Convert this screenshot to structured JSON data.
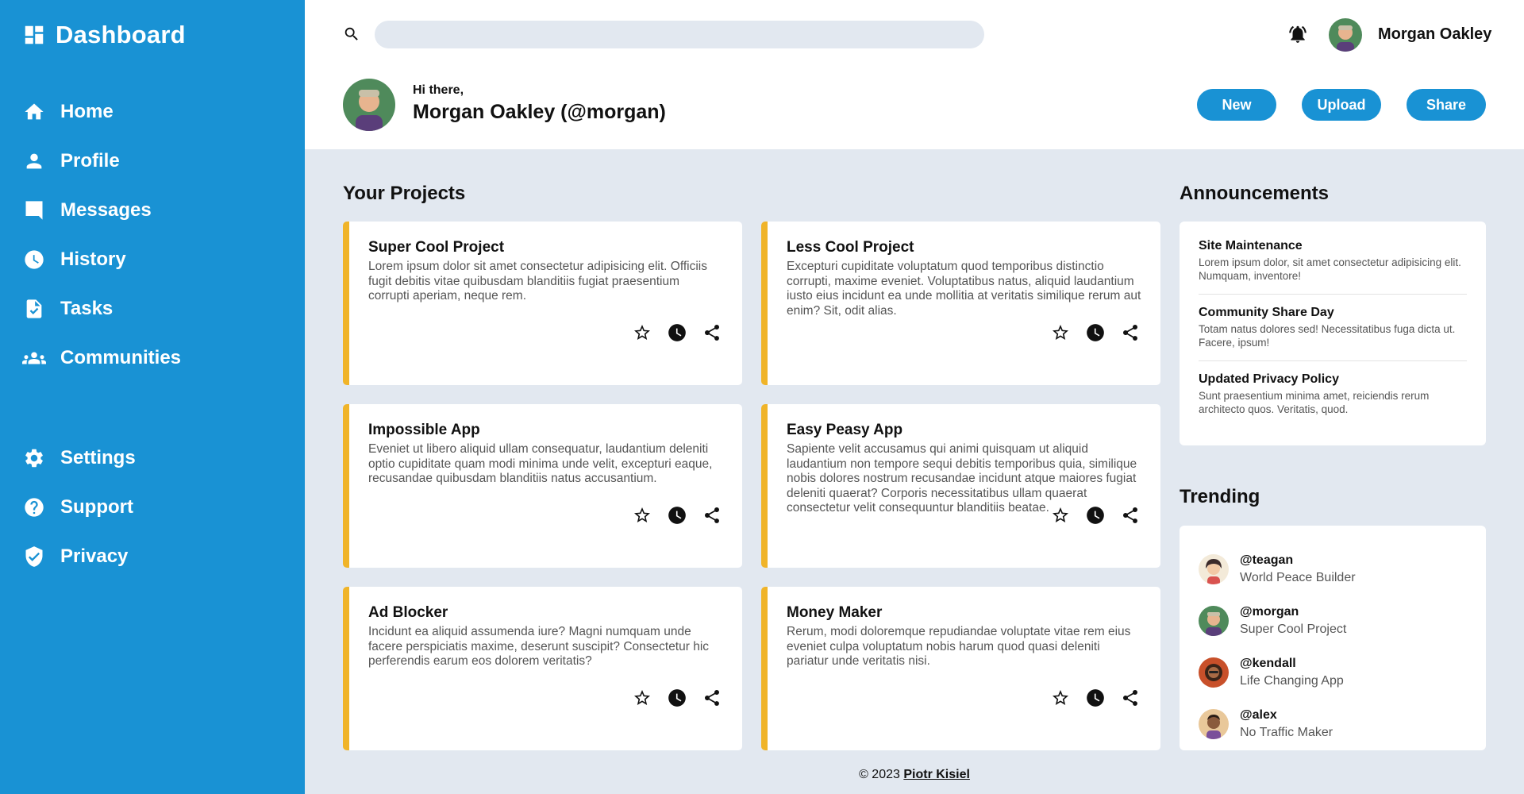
{
  "sidebar": {
    "brand": "Dashboard",
    "main_items": [
      {
        "label": "Home",
        "icon": "home-icon"
      },
      {
        "label": "Profile",
        "icon": "person-icon"
      },
      {
        "label": "Messages",
        "icon": "chat-icon"
      },
      {
        "label": "History",
        "icon": "clock-icon"
      },
      {
        "label": "Tasks",
        "icon": "task-icon"
      },
      {
        "label": "Communities",
        "icon": "group-icon"
      }
    ],
    "bottom_items": [
      {
        "label": "Settings",
        "icon": "gear-icon"
      },
      {
        "label": "Support",
        "icon": "help-icon"
      },
      {
        "label": "Privacy",
        "icon": "shield-icon"
      }
    ]
  },
  "header": {
    "search_placeholder": "",
    "user_name": "Morgan Oakley",
    "greeting": "Hi there,",
    "greeting_name": "Morgan Oakley (@morgan)",
    "buttons": {
      "new": "New",
      "upload": "Upload",
      "share": "Share"
    }
  },
  "projects": {
    "title": "Your Projects",
    "items": [
      {
        "title": "Super Cool Project",
        "desc": "Lorem ipsum dolor sit amet consectetur adipisicing elit. Officiis fugit debitis vitae quibusdam blanditiis fugiat praesentium corrupti aperiam, neque rem."
      },
      {
        "title": "Less Cool Project",
        "desc": "Excepturi cupiditate voluptatum quod temporibus distinctio corrupti, maxime eveniet. Voluptatibus natus, aliquid laudantium iusto eius incidunt ea unde mollitia at veritatis similique rerum aut enim? Sit, odit alias."
      },
      {
        "title": "Impossible App",
        "desc": "Eveniet ut libero aliquid ullam consequatur, laudantium deleniti optio cupiditate quam modi minima unde velit, excepturi eaque, recusandae quibusdam blanditiis natus accusantium."
      },
      {
        "title": "Easy Peasy App",
        "desc": "Sapiente velit accusamus qui animi quisquam ut aliquid laudantium non tempore sequi debitis temporibus quia, similique nobis dolores nostrum recusandae incidunt atque maiores fugiat deleniti quaerat? Corporis necessitatibus ullam quaerat consectetur velit consequuntur blanditiis beatae."
      },
      {
        "title": "Ad Blocker",
        "desc": "Incidunt ea aliquid assumenda iure? Magni numquam unde facere perspiciatis maxime, deserunt suscipit? Consectetur hic perferendis earum eos dolorem veritatis?"
      },
      {
        "title": "Money Maker",
        "desc": "Rerum, modi doloremque repudiandae voluptate vitae rem eius eveniet culpa voluptatum nobis harum quod quasi deleniti pariatur unde veritatis nisi."
      }
    ]
  },
  "announcements": {
    "title": "Announcements",
    "items": [
      {
        "title": "Site Maintenance",
        "desc": "Lorem ipsum dolor, sit amet consectetur adipisicing elit. Numquam, inventore!"
      },
      {
        "title": "Community Share Day",
        "desc": "Totam natus dolores sed! Necessitatibus fuga dicta ut. Facere, ipsum!"
      },
      {
        "title": "Updated Privacy Policy",
        "desc": "Sunt praesentium minima amet, reiciendis rerum architecto quos. Veritatis, quod."
      }
    ]
  },
  "trending": {
    "title": "Trending",
    "items": [
      {
        "handle": "@teagan",
        "sub": "World Peace Builder"
      },
      {
        "handle": "@morgan",
        "sub": "Super Cool Project"
      },
      {
        "handle": "@kendall",
        "sub": "Life Changing App"
      },
      {
        "handle": "@alex",
        "sub": "No Traffic Maker"
      }
    ]
  },
  "footer": {
    "copyright": "© 2023",
    "author": "Piotr Kisiel"
  },
  "colors": {
    "primary": "#1992d4",
    "accent": "#f0b429",
    "background": "#e2e8f0"
  }
}
